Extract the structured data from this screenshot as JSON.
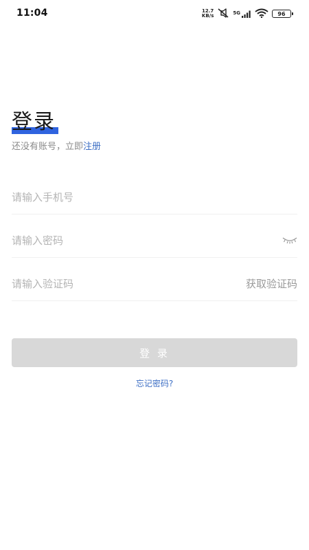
{
  "status_bar": {
    "time": "11:04",
    "net_speed_value": "12.7",
    "net_speed_unit": "KB/s",
    "signal_label": "5G",
    "battery": "96"
  },
  "login": {
    "title": "登录",
    "subtitle_prefix": "还没有账号，立即",
    "register_link": "注册",
    "phone_placeholder": "请输入手机号",
    "password_placeholder": "请输入密码",
    "code_placeholder": "请输入验证码",
    "get_code": "获取验证码",
    "submit": "登 录",
    "forgot": "忘记密码?"
  },
  "colors": {
    "accent": "#2f63df",
    "link": "#3c6ec4",
    "button_disabled": "#d8d8d8"
  },
  "icons": [
    "mute-icon",
    "signal-icon",
    "wifi-icon",
    "battery-icon",
    "eye-closed-icon"
  ]
}
